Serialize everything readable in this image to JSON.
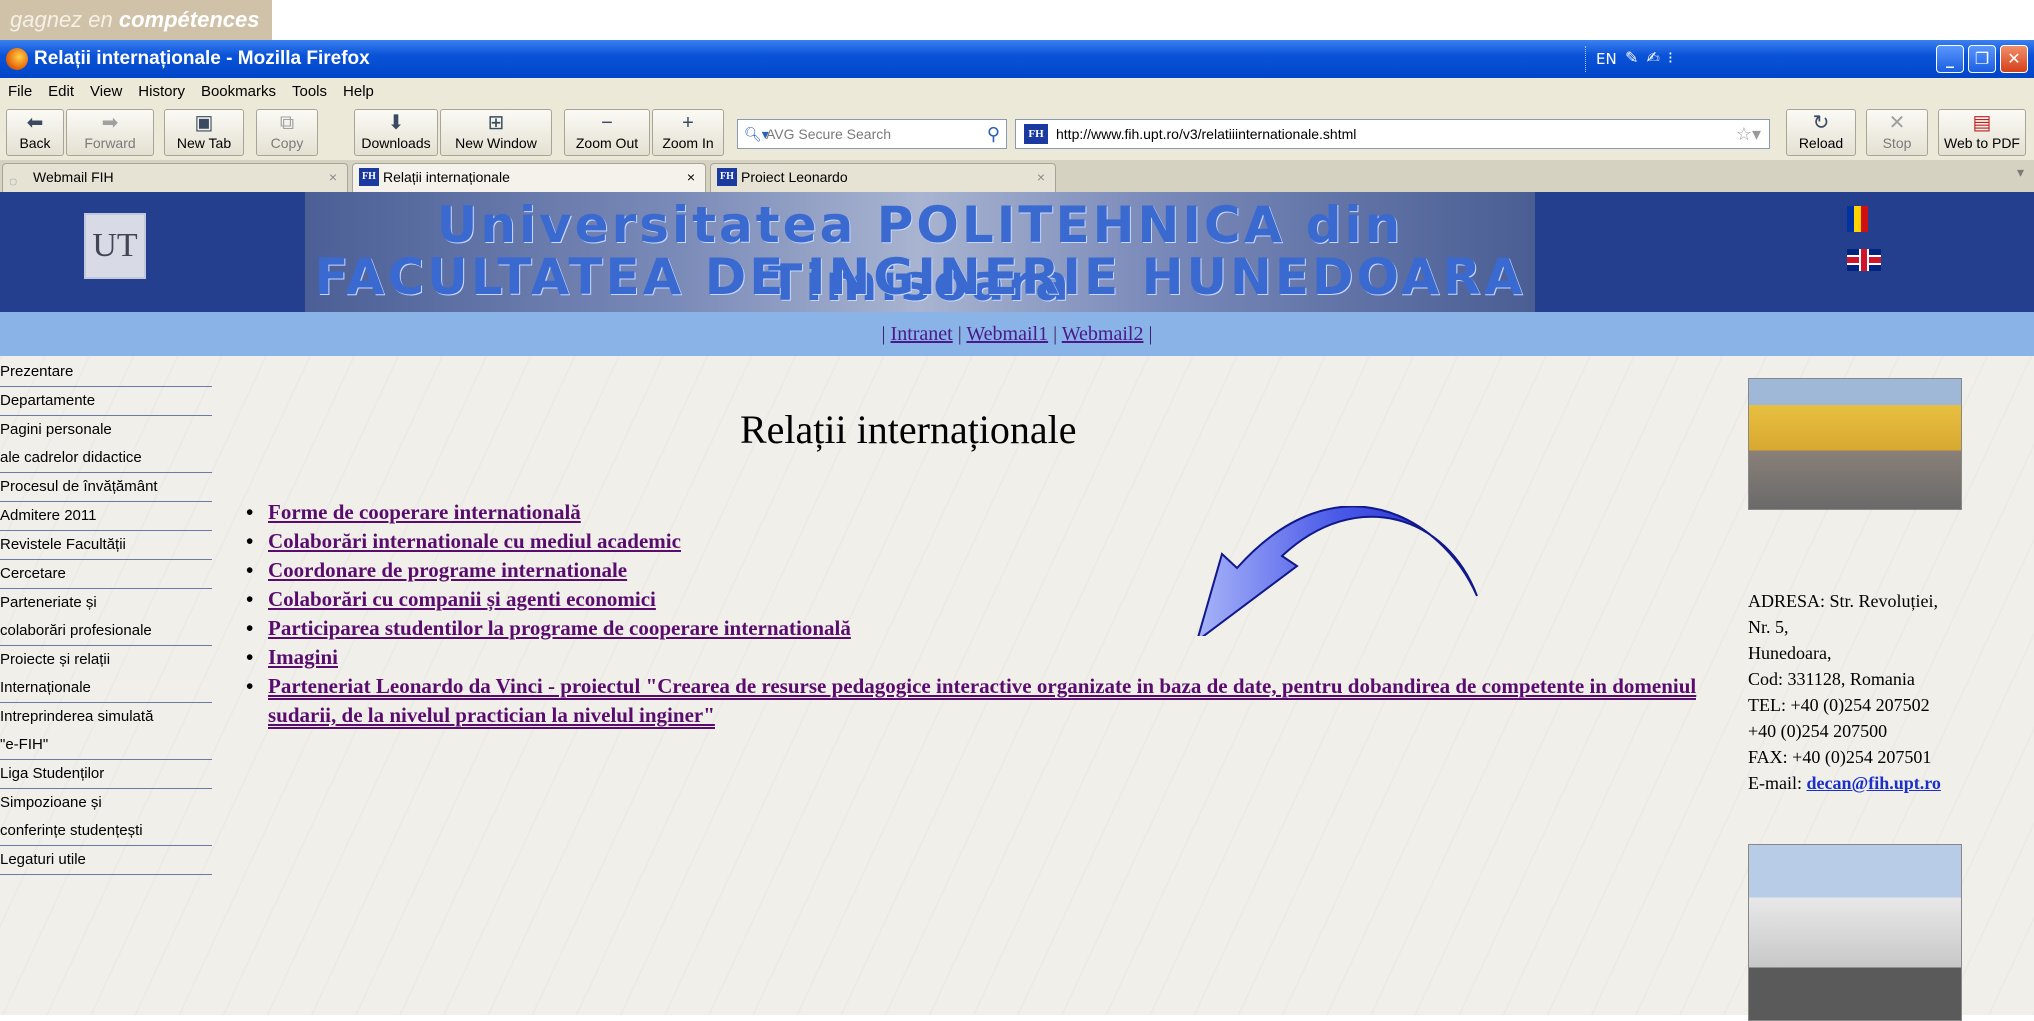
{
  "top_strip": {
    "text_normal": "gagnez en ",
    "text_bold": "compétences"
  },
  "window": {
    "title": "Relații internaționale - Mozilla Firefox",
    "lang": "EN",
    "min": "_",
    "max": "❐",
    "close": "✕"
  },
  "menu": [
    "File",
    "Edit",
    "View",
    "History",
    "Bookmarks",
    "Tools",
    "Help"
  ],
  "toolbar": {
    "back": "Back",
    "forward": "Forward",
    "new_tab": "New Tab",
    "copy": "Copy",
    "downloads": "Downloads",
    "new_window": "New Window",
    "zoom_out": "Zoom Out",
    "zoom_in": "Zoom In",
    "reload": "Reload",
    "stop": "Stop",
    "web_to_pdf": "Web to PDF",
    "search_placeholder": "AVG Secure Search",
    "url": "http://www.fih.upt.ro/v3/relatiiinternationale.shtml"
  },
  "tabs": [
    {
      "label": "Webmail FIH",
      "active": false
    },
    {
      "label": "Relații internaționale",
      "active": true
    },
    {
      "label": "Proiect Leonardo",
      "active": false
    }
  ],
  "header": {
    "banner_line1": "Universitatea POLITEHNICA din Timisoara",
    "banner_line2": "FACULTATEA DE INGINERIE HUNEDOARA"
  },
  "navlinks": {
    "intranet": "Intranet",
    "webmail1": "Webmail1",
    "webmail2": "Webmail2"
  },
  "sidebar": [
    "Prezentare",
    "Departamente",
    "Pagini personale",
    "ale cadrelor didactice",
    "Procesul de învățământ",
    "Admitere 2011",
    "Revistele Facultății",
    "Cercetare",
    "Parteneriate și",
    "colaborări profesionale",
    "Proiecte și relații",
    "Internaționale",
    "Intreprinderea simulată",
    "\"e-FIH\"",
    "Liga Studenților",
    "Simpozioane și",
    "conferințe studențești",
    "Legaturi utile"
  ],
  "page_title": "Relații internaționale",
  "links": [
    "Forme de cooperare internatională",
    "Colaborări internationale cu mediul academic",
    "Coordonare de programe internationale",
    "Colaborări cu companii și agenti economici",
    "Participarea studentilor la programe de cooperare internatională",
    "Imagini",
    "Parteneriat Leonardo da Vinci - proiectul \"Crearea de resurse pedagogice interactive organizate in baza de date, pentru dobandirea de competente in domeniul sudarii, de la nivelul practician la nivelul inginer\""
  ],
  "address": {
    "line1": "ADRESA: Str. Revoluției,",
    "line2": "Nr. 5,",
    "line3": "Hunedoara,",
    "line4": "Cod: 331128, Romania",
    "line5": "TEL: +40 (0)254 207502",
    "line6": "+40 (0)254 207500",
    "line7": "FAX: +40 (0)254 207501",
    "email_label": "E-mail: ",
    "email": "decan@fih.upt.ro"
  },
  "colors": {
    "titlebar": "#0a53d8",
    "header_bg": "#233f8e",
    "nav_bg": "#8ab4e8",
    "link": "#5a0c6e",
    "arrow": "#2a3ad8"
  },
  "icons": [
    "firefox-icon",
    "back-arrow-icon",
    "forward-arrow-icon",
    "new-tab-icon",
    "copy-icon",
    "download-icon",
    "new-window-icon",
    "zoom-out-icon",
    "zoom-in-icon",
    "search-icon",
    "bookmark-star-icon",
    "reload-icon",
    "stop-icon",
    "pdf-icon",
    "curved-arrow-icon"
  ]
}
